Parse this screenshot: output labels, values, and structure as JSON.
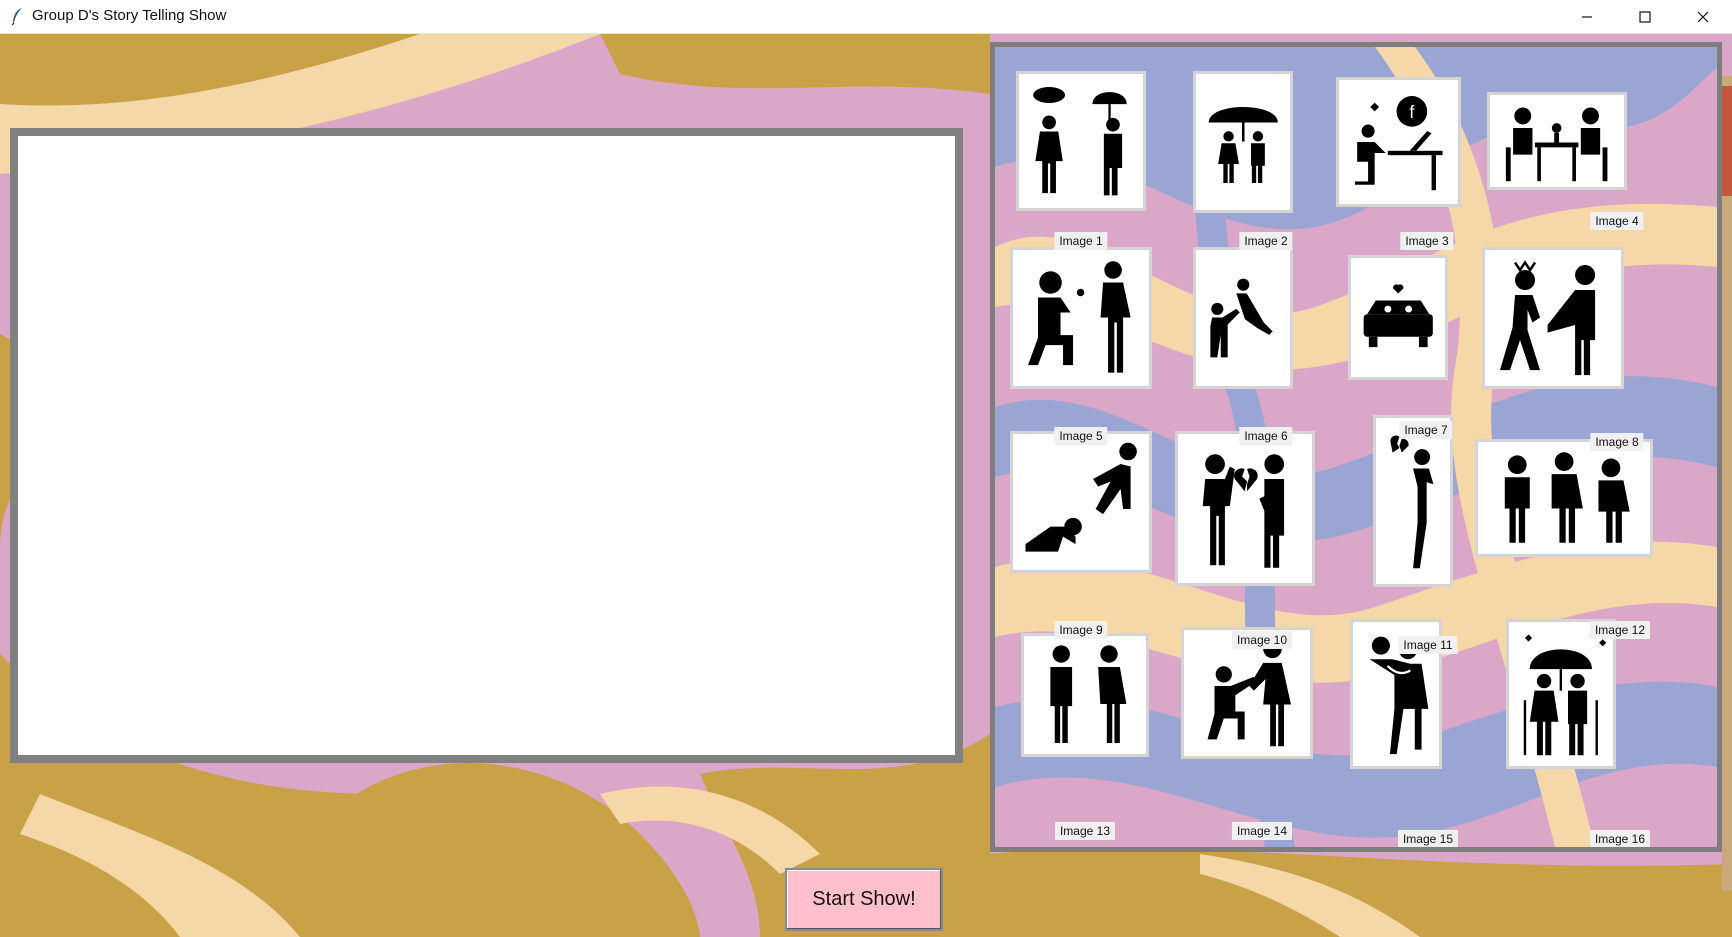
{
  "window": {
    "title": "Group D's Story Telling Show",
    "icon": "feather-icon",
    "controls": [
      "minimize-icon",
      "maximize-icon",
      "close-icon"
    ]
  },
  "colors": {
    "background_mustard": "#c9a147",
    "background_pink": "#dba7c8",
    "background_cream": "#f6d7a8",
    "background_periwinkle": "#9aa5d4",
    "canvas_border": "#808080",
    "button_pink": "#ffc0cb"
  },
  "main": {
    "start_button_label": "Start Show!"
  },
  "gallery": {
    "images": [
      {
        "label": "Image 1",
        "icon": "couple-rain-umbrella-icon"
      },
      {
        "label": "Image 2",
        "icon": "couple-under-umbrella-icon"
      },
      {
        "label": "Image 3",
        "icon": "person-at-laptop-facebook-icon"
      },
      {
        "label": "Image 4",
        "icon": "couple-dinner-table-icon"
      },
      {
        "label": "Image 5",
        "icon": "kneeling-flower-proposal-icon"
      },
      {
        "label": "Image 6",
        "icon": "lifting-partner-icon"
      },
      {
        "label": "Image 7",
        "icon": "couple-in-car-icon"
      },
      {
        "label": "Image 8",
        "icon": "angry-push-icon"
      },
      {
        "label": "Image 9",
        "icon": "kicked-away-icon"
      },
      {
        "label": "Image 10",
        "icon": "broken-heart-couple-icon"
      },
      {
        "label": "Image 11",
        "icon": "sad-broken-heart-person-icon"
      },
      {
        "label": "Image 12",
        "icon": "three-people-icon"
      },
      {
        "label": "Image 13",
        "icon": "couple-standing-icon"
      },
      {
        "label": "Image 14",
        "icon": "kneeling-proposal-icon"
      },
      {
        "label": "Image 15",
        "icon": "couple-hug-icon"
      },
      {
        "label": "Image 16",
        "icon": "elderly-couple-umbrella-icon"
      }
    ]
  }
}
